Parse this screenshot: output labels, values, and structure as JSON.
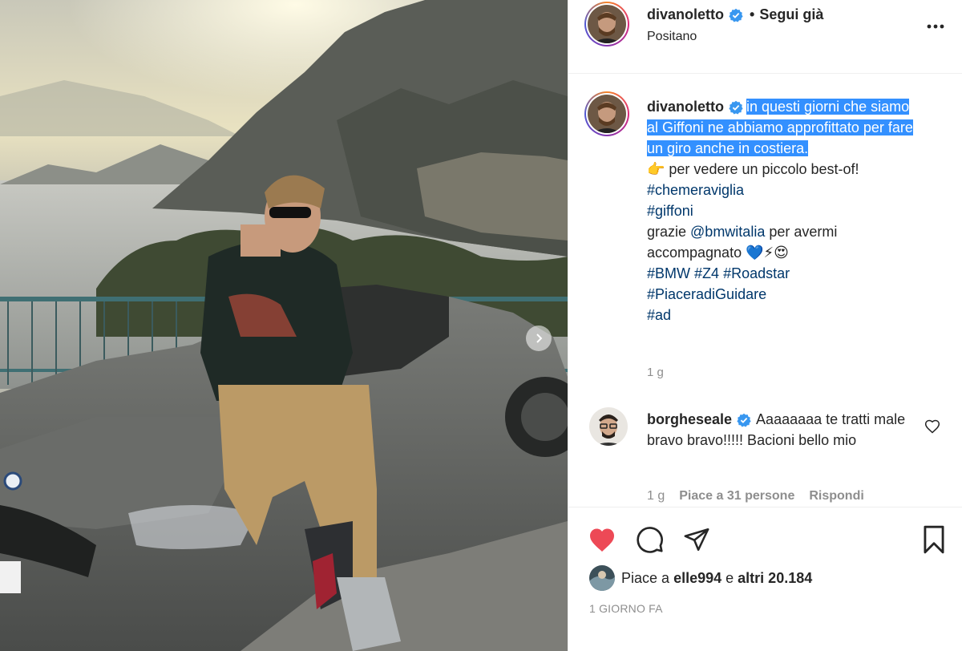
{
  "post": {
    "username": "divanoletto",
    "follow_status": "Segui già",
    "location": "Positano",
    "more_icon": "more-horizontal-icon"
  },
  "caption": {
    "username": "divanoletto",
    "highlighted_text": "in questi giorni che siamo al Giffoni ne abbiamo approfittato per fare un giro anche in costiera.",
    "line_pointer": "👉 per vedere un piccolo best-of!",
    "hashtag1": "#chemeraviglia",
    "hashtag2": "#giffoni",
    "thanks_prefix": "grazie ",
    "mention": "@bmwitalia",
    "thanks_suffix": " per avermi accompagnato 💙⚡😍",
    "tag_bmw": "#BMW",
    "tag_z4": "#Z4",
    "tag_roadstar": "#Roadstar",
    "tag_piacere": "#PiaceradiGuidare",
    "tag_ad": "#ad",
    "time": "1 g"
  },
  "comment": {
    "username": "borgheseale",
    "text": "Aaaaaaaa te tratti male bravo bravo!!!!! Bacioni bello mio",
    "time": "1 g",
    "likes": "Piace a 31 persone",
    "reply": "Rispondi"
  },
  "actions": {
    "likes_prefix": "Piace a ",
    "likes_user": "elle994",
    "likes_middle": " e ",
    "likes_others": "altri 20.184",
    "date": "1 GIORNO FA"
  },
  "colors": {
    "like_red": "#ed4956",
    "verified_blue": "#3897f0",
    "hashtag_blue": "#00376b",
    "selection_blue": "#3390ff"
  }
}
